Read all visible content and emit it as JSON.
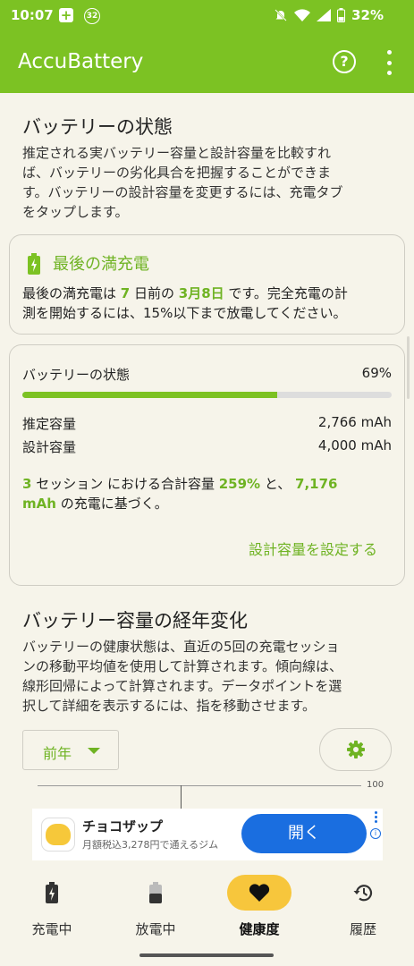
{
  "status_bar": {
    "time": "10:07",
    "notification_count": "32",
    "battery_pct": "32%"
  },
  "app_bar": {
    "title": "AccuBattery",
    "help_label": "?"
  },
  "battery_health": {
    "heading": "バッテリーの状態",
    "description_lines": [
      "推定される実バッテリー容量と設計容量を比較すれ",
      "ば、バッテリーの劣化具合を把握することができま",
      "す。バッテリーの設計容量を変更するには、充電タブ",
      "をタップします。"
    ]
  },
  "last_full_charge": {
    "title": "最後の満充電",
    "line1_prefix": "最後の満充電は ",
    "days": "7",
    "line1_mid": " 日前の ",
    "date": "3月8日",
    "line1_suffix": " です。完全充電の計",
    "line2": "測を開始するには、15%以下まで放電してください。"
  },
  "health_card": {
    "health_label": "バッテリーの状態",
    "health_value": "69%",
    "health_fraction": 0.69,
    "estimated_label": "推定容量",
    "estimated_value": "2,766 mAh",
    "design_label": "設計容量",
    "design_value": "4,000 mAh",
    "sessions": "3",
    "sessions_text": " セッション における合計容量 ",
    "total_pct": "259%",
    "and_text": " と、 ",
    "charged_num": "7,176",
    "charged_unit": "mAh",
    "charged_suffix": " の充電に基づく。",
    "set_design_link": "設計容量を設定する"
  },
  "capacity_trend": {
    "heading": "バッテリー容量の経年変化",
    "description_lines": [
      "バッテリーの健康状態は、直近の5回の充電セッショ",
      "ンの移動平均値を使用して計算されます。傾向線は、",
      "線形回帰によって計算されます。データポイントを選",
      "択して詳細を表示するには、指を移動させます。"
    ],
    "period_selected": "前年",
    "chart_label": "100"
  },
  "ad": {
    "name": "チョコザップ",
    "subtitle": "月額税込3,278円で通えるジム",
    "button": "開く",
    "info": "i"
  },
  "bottom_nav": {
    "items": [
      {
        "label": "充電中",
        "icon": "charging-battery-icon"
      },
      {
        "label": "放電中",
        "icon": "discharging-battery-icon"
      },
      {
        "label": "健康度",
        "icon": "heart-icon"
      },
      {
        "label": "履歴",
        "icon": "history-icon"
      }
    ],
    "active_index": 2
  },
  "colors": {
    "accent": "#7cc223",
    "accent_text": "#6fb323",
    "active_nav": "#f7c63c",
    "ad_button": "#1a6ee0"
  }
}
